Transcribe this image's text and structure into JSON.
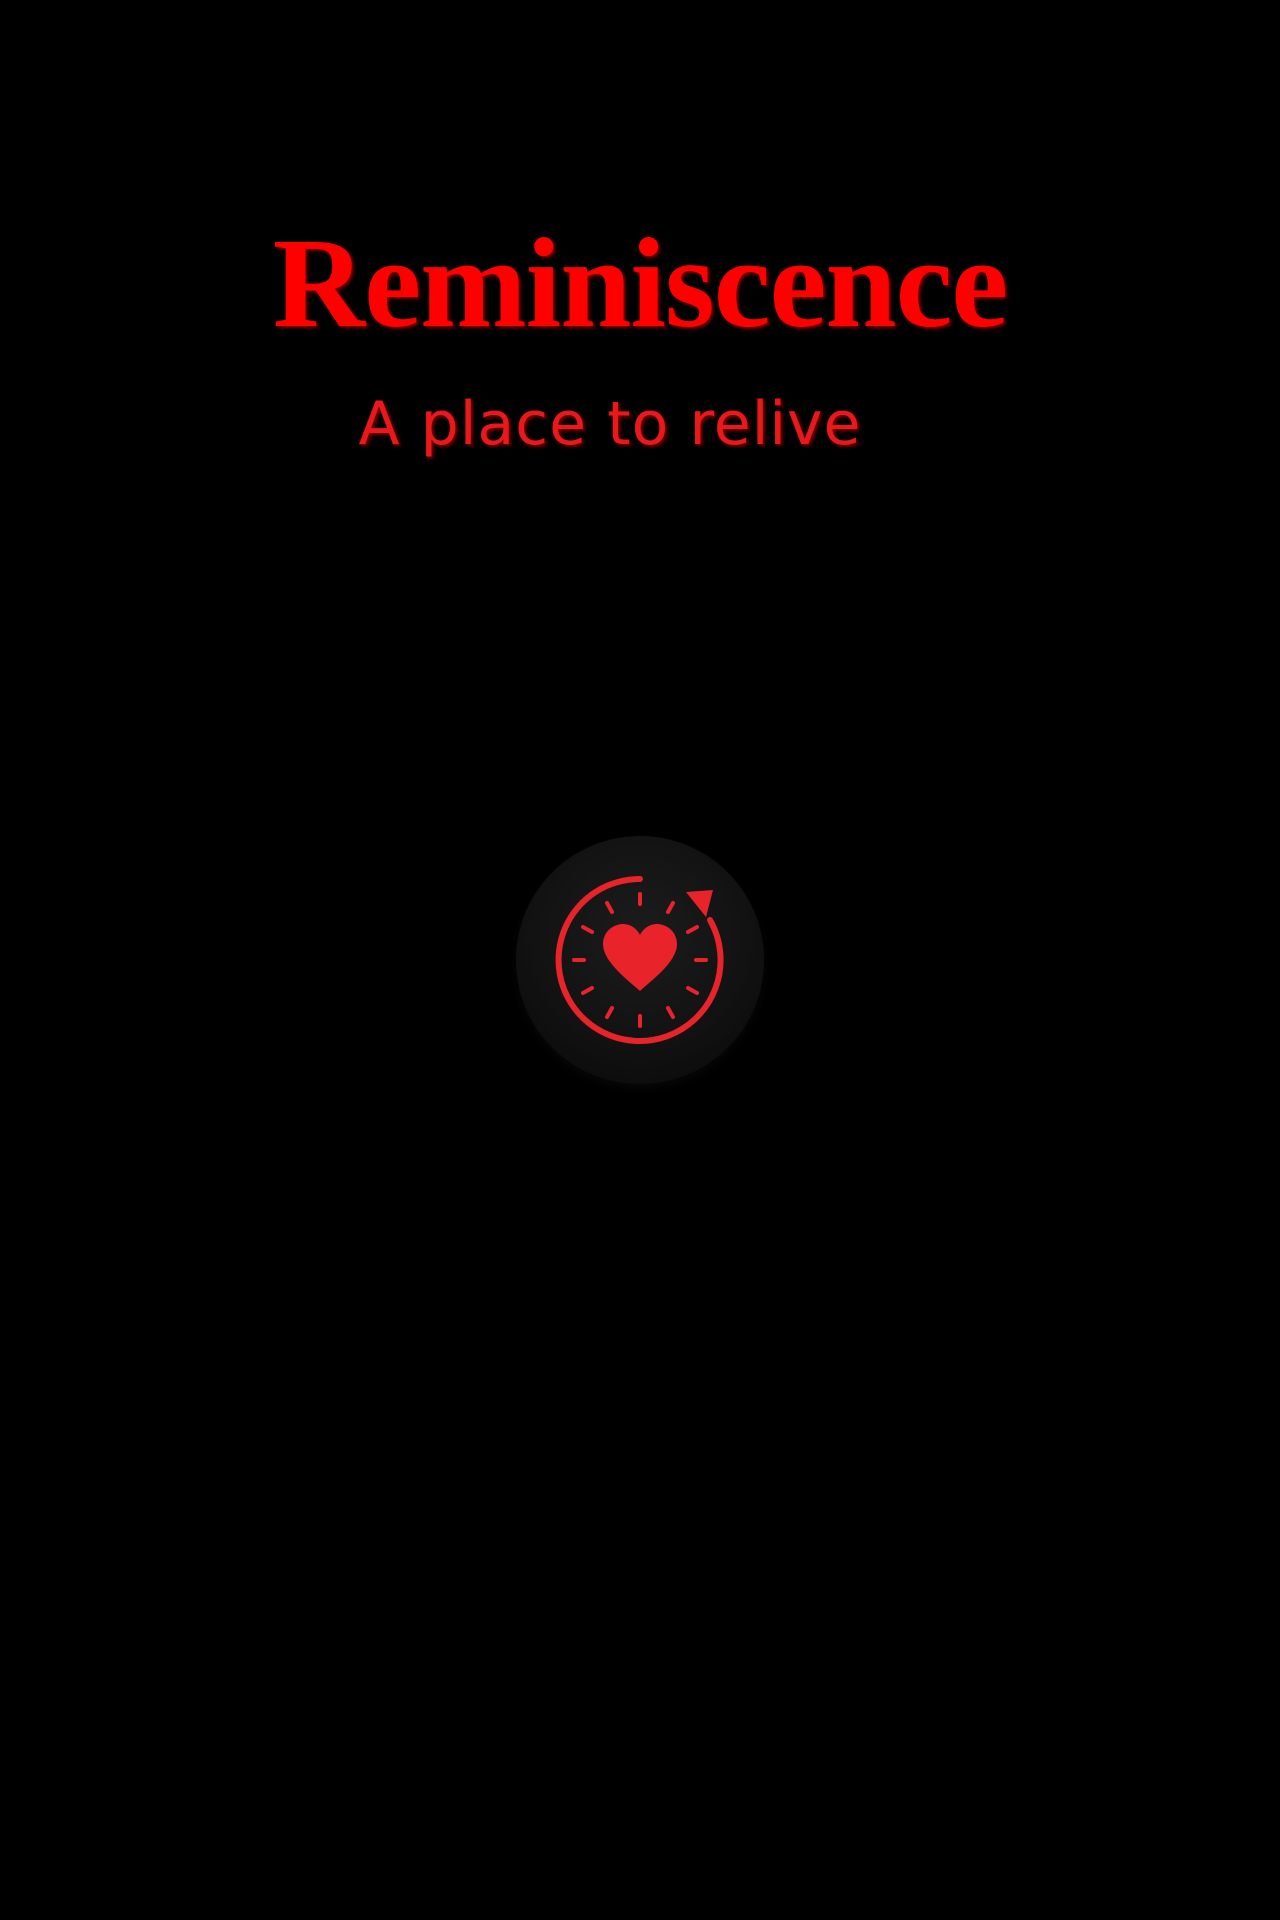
{
  "app": {
    "title": "Reminiscence",
    "tagline": "A place to relive"
  },
  "logo": {
    "icon": "heart-clock-replay-icon",
    "accent_color": "#e8232a"
  },
  "colors": {
    "background": "#000000",
    "title": "#ff0000",
    "tagline": "#e8181b"
  }
}
